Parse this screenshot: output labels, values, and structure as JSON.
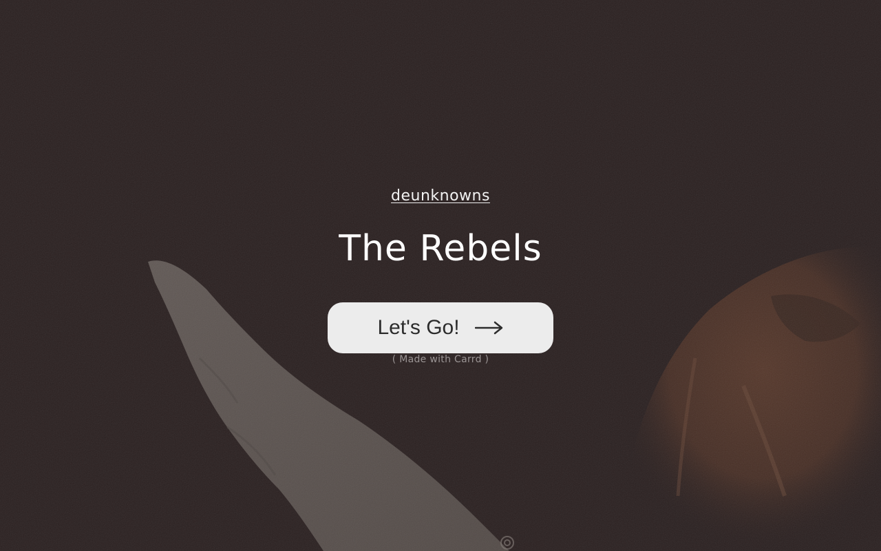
{
  "header": {
    "brand_link": "deunknowns"
  },
  "hero": {
    "title": "The Rebels"
  },
  "cta": {
    "label": "Let's Go!",
    "icon": "arrow-right-icon"
  },
  "footer": {
    "credit": "( Made with Carrd )"
  },
  "colors": {
    "background": "#2a2020",
    "button_bg": "#ececec",
    "button_text": "#2c2c2c",
    "title_text": "#ffffff",
    "credit_text": "#9a9494"
  }
}
